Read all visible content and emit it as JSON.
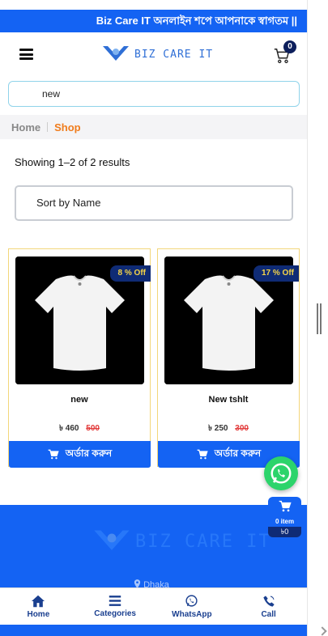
{
  "marquee": {
    "text": "Biz Care IT অনলাইন শপে আপনাকে স্বাগতম ||"
  },
  "header": {
    "logo_text": "BIZ CARE IT",
    "cart_count": "0"
  },
  "search": {
    "value": "new"
  },
  "breadcrumb": {
    "home": "Home",
    "current": "Shop"
  },
  "results": {
    "text": "Showing 1–2 of 2 results"
  },
  "sort": {
    "selected": "Sort by Name"
  },
  "products": [
    {
      "name": "new",
      "discount": "8 % Off",
      "price": "৳ 460",
      "old_price": "500",
      "order_label": "অর্ডার করুন"
    },
    {
      "name": "New tshlt",
      "discount": "17 % Off",
      "price": "৳ 250",
      "old_price": "300",
      "order_label": "অর্ডার করুন"
    }
  ],
  "mini_cart": {
    "items": "0 item",
    "total": "৳0"
  },
  "footer": {
    "logo_text": "BIZ CARE IT",
    "location": "Dhaka"
  },
  "bottom_nav": [
    {
      "label": "Home",
      "icon": "home-icon"
    },
    {
      "label": "Categories",
      "icon": "list-icon"
    },
    {
      "label": "WhatsApp",
      "icon": "whatsapp-icon"
    },
    {
      "label": "Call",
      "icon": "phone-icon"
    }
  ],
  "colors": {
    "primary": "#1463f3",
    "accent": "#f07c1c",
    "badge_bg": "#0f2b75",
    "badge_text": "#f6d547",
    "old_price": "#e23b3b"
  }
}
